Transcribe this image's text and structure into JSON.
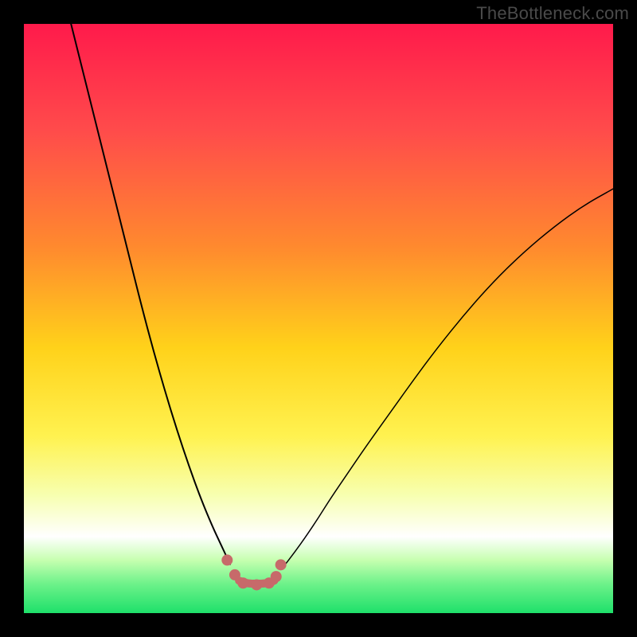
{
  "watermark": "TheBottleneck.com",
  "chart_data": {
    "type": "line",
    "title": "",
    "xlabel": "",
    "ylabel": "",
    "xlim": [
      0,
      100
    ],
    "ylim": [
      0,
      100
    ],
    "grid": false,
    "legend": false,
    "background_gradient": {
      "direction": "vertical",
      "stops": [
        {
          "offset": 0,
          "color": "#ff1a4b"
        },
        {
          "offset": 18,
          "color": "#ff4b4b"
        },
        {
          "offset": 38,
          "color": "#ff8a2e"
        },
        {
          "offset": 55,
          "color": "#ffd21a"
        },
        {
          "offset": 70,
          "color": "#fff250"
        },
        {
          "offset": 80,
          "color": "#f7ffb0"
        },
        {
          "offset": 87,
          "color": "#ffffff"
        },
        {
          "offset": 91,
          "color": "#c6ffb0"
        },
        {
          "offset": 95,
          "color": "#6ef28a"
        },
        {
          "offset": 100,
          "color": "#1ee06a"
        }
      ]
    },
    "series": [
      {
        "name": "left-curve",
        "stroke": "#000000",
        "stroke_width": 2,
        "x": [
          8,
          10,
          12,
          14,
          16,
          18,
          20,
          22,
          24,
          26,
          28,
          30,
          32,
          33.5,
          35
        ],
        "y": [
          100,
          92,
          84,
          76,
          68,
          60,
          52,
          44.5,
          37.5,
          31,
          25,
          19.5,
          14.7,
          11.5,
          8.3
        ]
      },
      {
        "name": "right-curve",
        "stroke": "#000000",
        "stroke_width": 1.5,
        "x": [
          44,
          46,
          48,
          50,
          52,
          55,
          58,
          62,
          66,
          70,
          75,
          80,
          85,
          90,
          95,
          100
        ],
        "y": [
          7.8,
          10.4,
          13.2,
          16.2,
          19.4,
          23.8,
          28.2,
          33.8,
          39.4,
          44.8,
          51,
          56.6,
          61.4,
          65.6,
          69.2,
          72.0
        ]
      },
      {
        "name": "valley-min",
        "stroke": "#c76a6a",
        "stroke_width": 10,
        "x": [
          36.5,
          38,
          39.5,
          41,
          42.5
        ],
        "y": [
          5.5,
          5.0,
          5.0,
          5.0,
          5.5
        ]
      }
    ],
    "valley_dots": {
      "color": "#c76a6a",
      "radius": 7,
      "points": [
        {
          "x": 34.5,
          "y": 9.0
        },
        {
          "x": 35.8,
          "y": 6.5
        },
        {
          "x": 37.2,
          "y": 5.1
        },
        {
          "x": 39.5,
          "y": 4.8
        },
        {
          "x": 41.6,
          "y": 5.1
        },
        {
          "x": 42.8,
          "y": 6.2
        },
        {
          "x": 43.6,
          "y": 8.2
        }
      ]
    }
  }
}
